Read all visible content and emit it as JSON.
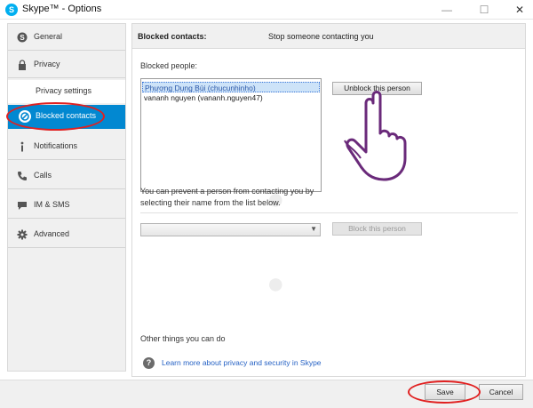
{
  "window": {
    "title": "Skype™ - Options",
    "min_glyph": "—",
    "max_glyph": "☐",
    "close_glyph": "✕"
  },
  "sidebar": {
    "items": [
      {
        "label": "General",
        "icon": "skype-icon"
      },
      {
        "label": "Privacy",
        "icon": "lock-icon"
      },
      {
        "label": "Privacy settings"
      },
      {
        "label": "Blocked contacts",
        "icon": "blocked-icon",
        "active": true
      },
      {
        "label": "Notifications",
        "icon": "info-icon"
      },
      {
        "label": "Calls",
        "icon": "phone-icon"
      },
      {
        "label": "IM & SMS",
        "icon": "chat-icon"
      },
      {
        "label": "Advanced",
        "icon": "gear-icon"
      }
    ]
  },
  "panel": {
    "header_bold": "Blocked contacts:",
    "header_text": "Stop someone contacting you",
    "blocked_label": "Blocked people:",
    "blocked_list": [
      "Phương Dung Bùi (chucunhinho)",
      "vananh nguyen (vananh.nguyen47)"
    ],
    "unblock_button": "Unblock this person",
    "prevent_text": "You can prevent a person from contacting you by selecting their name from the list below.",
    "block_button": "Block this person",
    "other_things": "Other things you can do",
    "help_link": "Learn more about privacy and security in Skype"
  },
  "footer": {
    "save": "Save",
    "cancel": "Cancel"
  },
  "colors": {
    "accent": "#0288d1",
    "annotation": "#e02020",
    "hand_outline": "#6a2a7a"
  }
}
